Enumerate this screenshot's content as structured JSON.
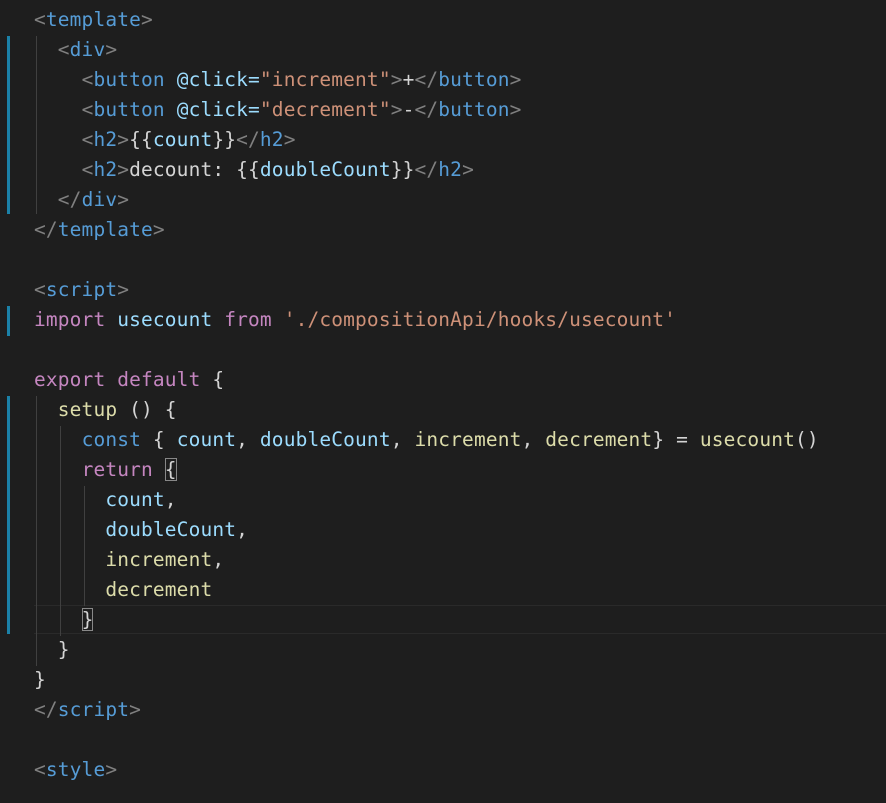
{
  "editor": {
    "language": "vue",
    "active_line": 21,
    "lines": [
      [
        {
          "t": "<",
          "c": "punc"
        },
        {
          "t": "template",
          "c": "tag"
        },
        {
          "t": ">",
          "c": "punc"
        }
      ],
      [
        {
          "t": "  "
        },
        {
          "t": "<",
          "c": "punc"
        },
        {
          "t": "div",
          "c": "tag"
        },
        {
          "t": ">",
          "c": "punc"
        }
      ],
      [
        {
          "t": "    "
        },
        {
          "t": "<",
          "c": "punc"
        },
        {
          "t": "button",
          "c": "tag"
        },
        {
          "t": " "
        },
        {
          "t": "@click=",
          "c": "attr"
        },
        {
          "t": "\"increment\"",
          "c": "str"
        },
        {
          "t": ">",
          "c": "punc"
        },
        {
          "t": "+",
          "c": "text"
        },
        {
          "t": "</",
          "c": "punc"
        },
        {
          "t": "button",
          "c": "tag"
        },
        {
          "t": ">",
          "c": "punc"
        }
      ],
      [
        {
          "t": "    "
        },
        {
          "t": "<",
          "c": "punc"
        },
        {
          "t": "button",
          "c": "tag"
        },
        {
          "t": " "
        },
        {
          "t": "@click=",
          "c": "attr"
        },
        {
          "t": "\"decrement\"",
          "c": "str"
        },
        {
          "t": ">",
          "c": "punc"
        },
        {
          "t": "-",
          "c": "text"
        },
        {
          "t": "</",
          "c": "punc"
        },
        {
          "t": "button",
          "c": "tag"
        },
        {
          "t": ">",
          "c": "punc"
        }
      ],
      [
        {
          "t": "    "
        },
        {
          "t": "<",
          "c": "punc"
        },
        {
          "t": "h2",
          "c": "tag"
        },
        {
          "t": ">",
          "c": "punc"
        },
        {
          "t": "{{",
          "c": "text"
        },
        {
          "t": "count",
          "c": "var"
        },
        {
          "t": "}}",
          "c": "text"
        },
        {
          "t": "</",
          "c": "punc"
        },
        {
          "t": "h2",
          "c": "tag"
        },
        {
          "t": ">",
          "c": "punc"
        }
      ],
      [
        {
          "t": "    "
        },
        {
          "t": "<",
          "c": "punc"
        },
        {
          "t": "h2",
          "c": "tag"
        },
        {
          "t": ">",
          "c": "punc"
        },
        {
          "t": "decount: ",
          "c": "text"
        },
        {
          "t": "{{",
          "c": "text"
        },
        {
          "t": "doubleCount",
          "c": "var"
        },
        {
          "t": "}}",
          "c": "text"
        },
        {
          "t": "</",
          "c": "punc"
        },
        {
          "t": "h2",
          "c": "tag"
        },
        {
          "t": ">",
          "c": "punc"
        }
      ],
      [
        {
          "t": "  "
        },
        {
          "t": "</",
          "c": "punc"
        },
        {
          "t": "div",
          "c": "tag"
        },
        {
          "t": ">",
          "c": "punc"
        }
      ],
      [
        {
          "t": "</",
          "c": "punc"
        },
        {
          "t": "template",
          "c": "tag"
        },
        {
          "t": ">",
          "c": "punc"
        }
      ],
      [],
      [
        {
          "t": "<",
          "c": "punc"
        },
        {
          "t": "script",
          "c": "tag"
        },
        {
          "t": ">",
          "c": "punc"
        }
      ],
      [
        {
          "t": "import",
          "c": "kw"
        },
        {
          "t": " "
        },
        {
          "t": "usecount",
          "c": "var"
        },
        {
          "t": " "
        },
        {
          "t": "from",
          "c": "kw"
        },
        {
          "t": " "
        },
        {
          "t": "'./compositionApi/hooks/usecount'",
          "c": "str"
        }
      ],
      [],
      [
        {
          "t": "export",
          "c": "kw"
        },
        {
          "t": " "
        },
        {
          "t": "default",
          "c": "kw"
        },
        {
          "t": " {",
          "c": "text"
        }
      ],
      [
        {
          "t": "  "
        },
        {
          "t": "setup",
          "c": "fn"
        },
        {
          "t": " () {",
          "c": "text"
        }
      ],
      [
        {
          "t": "    "
        },
        {
          "t": "const",
          "c": "decl"
        },
        {
          "t": " { ",
          "c": "text"
        },
        {
          "t": "count",
          "c": "var"
        },
        {
          "t": ", ",
          "c": "text"
        },
        {
          "t": "doubleCount",
          "c": "var"
        },
        {
          "t": ", ",
          "c": "text"
        },
        {
          "t": "increment",
          "c": "fn"
        },
        {
          "t": ", ",
          "c": "text"
        },
        {
          "t": "decrement",
          "c": "fn"
        },
        {
          "t": "} = ",
          "c": "text"
        },
        {
          "t": "usecount",
          "c": "fn"
        },
        {
          "t": "()",
          "c": "text"
        }
      ],
      [
        {
          "t": "    "
        },
        {
          "t": "return",
          "c": "kw"
        },
        {
          "t": " "
        },
        {
          "t": "{",
          "c": "text",
          "m": 1
        }
      ],
      [
        {
          "t": "      "
        },
        {
          "t": "count",
          "c": "var"
        },
        {
          "t": ",",
          "c": "text"
        }
      ],
      [
        {
          "t": "      "
        },
        {
          "t": "doubleCount",
          "c": "var"
        },
        {
          "t": ",",
          "c": "text"
        }
      ],
      [
        {
          "t": "      "
        },
        {
          "t": "increment",
          "c": "fn"
        },
        {
          "t": ",",
          "c": "text"
        }
      ],
      [
        {
          "t": "      "
        },
        {
          "t": "decrement",
          "c": "fn"
        }
      ],
      [
        {
          "t": "    "
        },
        {
          "t": "}",
          "c": "text",
          "m": 1
        }
      ],
      [
        {
          "t": "  "
        },
        {
          "t": "}",
          "c": "text"
        }
      ],
      [
        {
          "t": "}",
          "c": "text"
        }
      ],
      [
        {
          "t": "</",
          "c": "punc"
        },
        {
          "t": "script",
          "c": "tag"
        },
        {
          "t": ">",
          "c": "punc"
        }
      ],
      [],
      [
        {
          "t": "<",
          "c": "punc"
        },
        {
          "t": "style",
          "c": "tag"
        },
        {
          "t": ">",
          "c": "punc"
        }
      ]
    ],
    "colors": {
      "background": "#1e1e1e",
      "tag": "#569cd6",
      "punctuation": "#808080",
      "attribute": "#9cdcfe",
      "string": "#ce9178",
      "keyword": "#c586c0",
      "function": "#dcdcaa",
      "variable": "#9cdcfe",
      "text": "#d4d4d4",
      "gutter_mark": "#1b81a8"
    }
  }
}
